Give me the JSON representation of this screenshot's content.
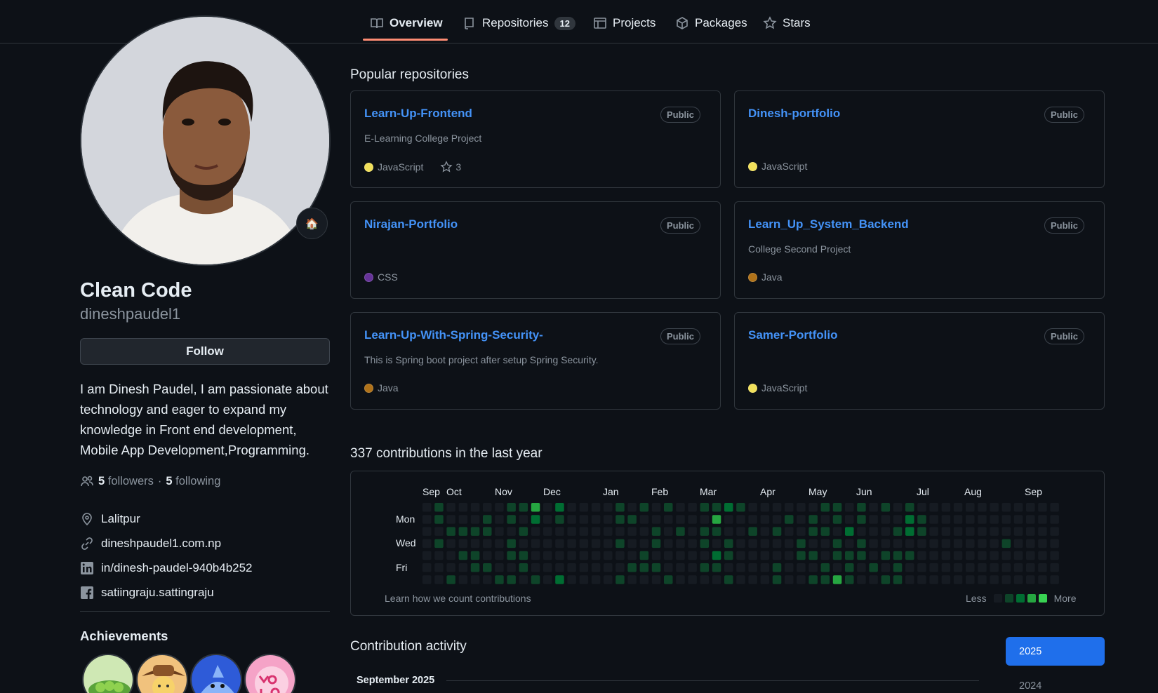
{
  "nav": {
    "tabs": [
      {
        "label": "Overview",
        "icon": "book-icon",
        "selected": true
      },
      {
        "label": "Repositories",
        "icon": "repo-icon",
        "count": "12"
      },
      {
        "label": "Projects",
        "icon": "table-icon"
      },
      {
        "label": "Packages",
        "icon": "package-icon"
      },
      {
        "label": "Stars",
        "icon": "star-icon"
      }
    ]
  },
  "profile": {
    "status_emoji": "🏠",
    "name": "Clean Code",
    "username": "dineshpaudel1",
    "follow_label": "Follow",
    "bio": "I am Dinesh Paudel, I am passionate about technology and eager to expand my knowledge in Front end development, Mobile App Development,Programming.",
    "followers_count": "5",
    "followers_label": "followers",
    "dot": "·",
    "following_count": "5",
    "following_label": "following",
    "location": "Lalitpur",
    "website": "dineshpaudel1.com.np",
    "linkedin": "in/dinesh-paudel-940b4b252",
    "facebook": "satiingraju.sattingraju"
  },
  "achievements": {
    "title": "Achievements"
  },
  "popular": {
    "title": "Popular repositories",
    "repos": [
      {
        "name": "Learn-Up-Frontend",
        "visibility": "Public",
        "description": "E-Learning College Project",
        "language": "JavaScript",
        "lang_color": "#f1e05a",
        "stars": "3"
      },
      {
        "name": "Dinesh-portfolio",
        "visibility": "Public",
        "description": "",
        "language": "JavaScript",
        "lang_color": "#f1e05a",
        "stars": ""
      },
      {
        "name": "Nirajan-Portfolio",
        "visibility": "Public",
        "description": "",
        "language": "CSS",
        "lang_color": "#663399",
        "stars": ""
      },
      {
        "name": "Learn_Up_System_Backend",
        "visibility": "Public",
        "description": "College Second Project",
        "language": "Java",
        "lang_color": "#b07219",
        "stars": ""
      },
      {
        "name": "Learn-Up-With-Spring-Security-",
        "visibility": "Public",
        "description": "This is Spring boot project after setup Spring Security.",
        "language": "Java",
        "lang_color": "#b07219",
        "stars": ""
      },
      {
        "name": "Samer-Portfolio",
        "visibility": "Public",
        "description": "",
        "language": "JavaScript",
        "lang_color": "#f1e05a",
        "stars": ""
      }
    ]
  },
  "contributions": {
    "title": "337 contributions in the last year",
    "months": [
      "Sep",
      "Oct",
      "Nov",
      "Dec",
      "Jan",
      "Feb",
      "Mar",
      "Apr",
      "May",
      "Jun",
      "Jul",
      "Aug",
      "Sep"
    ],
    "day_labels": [
      "Mon",
      "Wed",
      "Fri"
    ],
    "learn_label": "Learn how we count contributions",
    "legend_less": "Less",
    "legend_more": "More",
    "levels": [
      "#161b22",
      "#0e4429",
      "#006d32",
      "#26a641",
      "#39d353"
    ],
    "activity": [
      {
        "week": 1,
        "day": 0,
        "level": 1
      },
      {
        "week": 1,
        "day": 1,
        "level": 1
      },
      {
        "week": 1,
        "day": 3,
        "level": 1
      },
      {
        "week": 2,
        "day": 2,
        "level": 1
      },
      {
        "week": 2,
        "day": 6,
        "level": 1
      },
      {
        "week": 3,
        "day": 2,
        "level": 1
      },
      {
        "week": 3,
        "day": 4,
        "level": 1
      },
      {
        "week": 4,
        "day": 2,
        "level": 1
      },
      {
        "week": 4,
        "day": 4,
        "level": 1
      },
      {
        "week": 4,
        "day": 5,
        "level": 1
      },
      {
        "week": 5,
        "day": 1,
        "level": 1
      },
      {
        "week": 5,
        "day": 2,
        "level": 1
      },
      {
        "week": 5,
        "day": 5,
        "level": 1
      },
      {
        "week": 6,
        "day": 6,
        "level": 1
      },
      {
        "week": 7,
        "day": 0,
        "level": 1
      },
      {
        "week": 7,
        "day": 1,
        "level": 1
      },
      {
        "week": 7,
        "day": 3,
        "level": 1
      },
      {
        "week": 7,
        "day": 4,
        "level": 1
      },
      {
        "week": 7,
        "day": 6,
        "level": 1
      },
      {
        "week": 8,
        "day": 0,
        "level": 1
      },
      {
        "week": 8,
        "day": 2,
        "level": 1
      },
      {
        "week": 8,
        "day": 4,
        "level": 1
      },
      {
        "week": 8,
        "day": 5,
        "level": 1
      },
      {
        "week": 9,
        "day": 0,
        "level": 3
      },
      {
        "week": 9,
        "day": 1,
        "level": 2
      },
      {
        "week": 9,
        "day": 6,
        "level": 1
      },
      {
        "week": 11,
        "day": 0,
        "level": 2
      },
      {
        "week": 11,
        "day": 1,
        "level": 1
      },
      {
        "week": 11,
        "day": 6,
        "level": 2
      },
      {
        "week": 16,
        "day": 0,
        "level": 1
      },
      {
        "week": 16,
        "day": 1,
        "level": 1
      },
      {
        "week": 16,
        "day": 3,
        "level": 1
      },
      {
        "week": 16,
        "day": 6,
        "level": 1
      },
      {
        "week": 17,
        "day": 1,
        "level": 1
      },
      {
        "week": 17,
        "day": 5,
        "level": 1
      },
      {
        "week": 18,
        "day": 0,
        "level": 1
      },
      {
        "week": 18,
        "day": 4,
        "level": 1
      },
      {
        "week": 18,
        "day": 5,
        "level": 1
      },
      {
        "week": 19,
        "day": 2,
        "level": 1
      },
      {
        "week": 19,
        "day": 3,
        "level": 1
      },
      {
        "week": 19,
        "day": 5,
        "level": 1
      },
      {
        "week": 20,
        "day": 0,
        "level": 1
      },
      {
        "week": 20,
        "day": 6,
        "level": 1
      },
      {
        "week": 21,
        "day": 2,
        "level": 1
      },
      {
        "week": 23,
        "day": 0,
        "level": 1
      },
      {
        "week": 23,
        "day": 2,
        "level": 1
      },
      {
        "week": 23,
        "day": 3,
        "level": 1
      },
      {
        "week": 23,
        "day": 5,
        "level": 1
      },
      {
        "week": 24,
        "day": 0,
        "level": 1
      },
      {
        "week": 24,
        "day": 1,
        "level": 3
      },
      {
        "week": 24,
        "day": 4,
        "level": 2
      },
      {
        "week": 24,
        "day": 5,
        "level": 1
      },
      {
        "week": 24,
        "day": 2,
        "level": 1
      },
      {
        "week": 25,
        "day": 0,
        "level": 2
      },
      {
        "week": 25,
        "day": 3,
        "level": 1
      },
      {
        "week": 25,
        "day": 4,
        "level": 1
      },
      {
        "week": 25,
        "day": 6,
        "level": 1
      },
      {
        "week": 26,
        "day": 0,
        "level": 1
      },
      {
        "week": 27,
        "day": 2,
        "level": 1
      },
      {
        "week": 29,
        "day": 2,
        "level": 1
      },
      {
        "week": 29,
        "day": 5,
        "level": 1
      },
      {
        "week": 29,
        "day": 6,
        "level": 1
      },
      {
        "week": 30,
        "day": 1,
        "level": 1
      },
      {
        "week": 31,
        "day": 3,
        "level": 1
      },
      {
        "week": 31,
        "day": 4,
        "level": 1
      },
      {
        "week": 32,
        "day": 1,
        "level": 1
      },
      {
        "week": 32,
        "day": 2,
        "level": 1
      },
      {
        "week": 32,
        "day": 4,
        "level": 1
      },
      {
        "week": 32,
        "day": 6,
        "level": 1
      },
      {
        "week": 33,
        "day": 0,
        "level": 1
      },
      {
        "week": 33,
        "day": 2,
        "level": 1
      },
      {
        "week": 33,
        "day": 5,
        "level": 1
      },
      {
        "week": 33,
        "day": 6,
        "level": 1
      },
      {
        "week": 34,
        "day": 0,
        "level": 1
      },
      {
        "week": 34,
        "day": 1,
        "level": 1
      },
      {
        "week": 34,
        "day": 3,
        "level": 1
      },
      {
        "week": 34,
        "day": 4,
        "level": 1
      },
      {
        "week": 34,
        "day": 6,
        "level": 3
      },
      {
        "week": 35,
        "day": 2,
        "level": 2
      },
      {
        "week": 35,
        "day": 4,
        "level": 1
      },
      {
        "week": 35,
        "day": 5,
        "level": 1
      },
      {
        "week": 35,
        "day": 6,
        "level": 1
      },
      {
        "week": 36,
        "day": 0,
        "level": 1
      },
      {
        "week": 36,
        "day": 1,
        "level": 1
      },
      {
        "week": 36,
        "day": 3,
        "level": 1
      },
      {
        "week": 36,
        "day": 4,
        "level": 1
      },
      {
        "week": 37,
        "day": 5,
        "level": 1
      },
      {
        "week": 38,
        "day": 0,
        "level": 1
      },
      {
        "week": 38,
        "day": 4,
        "level": 1
      },
      {
        "week": 38,
        "day": 6,
        "level": 1
      },
      {
        "week": 39,
        "day": 2,
        "level": 1
      },
      {
        "week": 39,
        "day": 4,
        "level": 1
      },
      {
        "week": 39,
        "day": 5,
        "level": 1
      },
      {
        "week": 39,
        "day": 6,
        "level": 1
      },
      {
        "week": 40,
        "day": 0,
        "level": 1
      },
      {
        "week": 40,
        "day": 1,
        "level": 2
      },
      {
        "week": 40,
        "day": 2,
        "level": 2
      },
      {
        "week": 40,
        "day": 4,
        "level": 1
      },
      {
        "week": 41,
        "day": 1,
        "level": 1
      },
      {
        "week": 41,
        "day": 2,
        "level": 1
      },
      {
        "week": 48,
        "day": 3,
        "level": 1
      }
    ]
  },
  "activity": {
    "title": "Contribution activity",
    "selected_year": "2025",
    "other_year": "2024",
    "month_heading": "September 2025"
  }
}
